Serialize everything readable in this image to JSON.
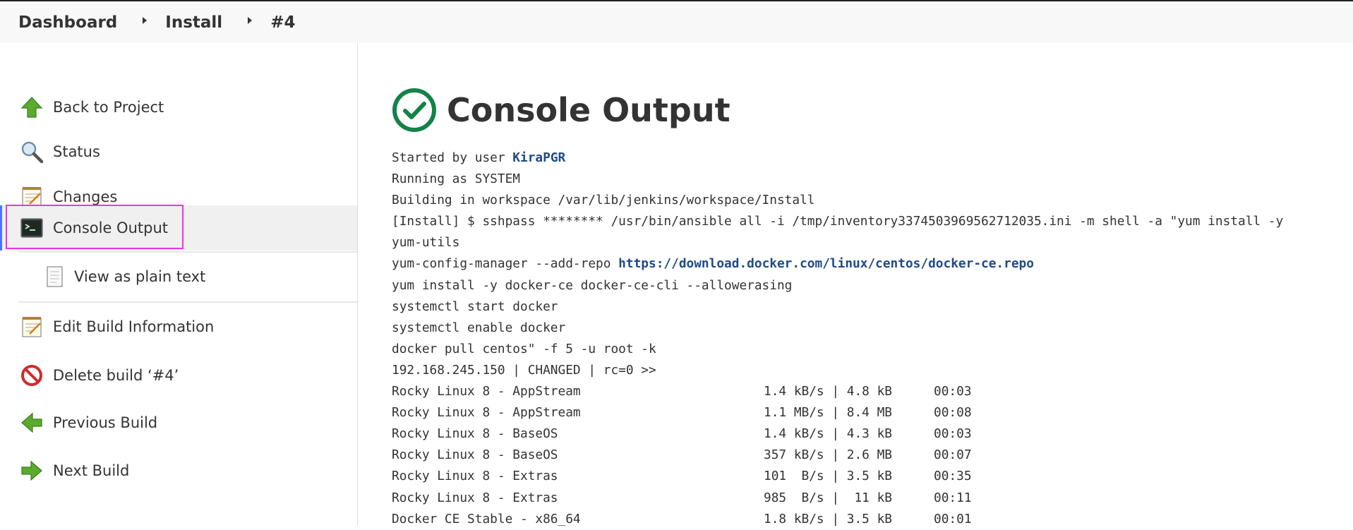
{
  "breadcrumb": {
    "items": [
      "Dashboard",
      "Install",
      "#4"
    ]
  },
  "sidebar": {
    "items": [
      {
        "label": "Back to Project",
        "icon": "up-arrow-icon"
      },
      {
        "label": "Status",
        "icon": "magnifier-icon"
      },
      {
        "label": "Changes",
        "icon": "notepad-icon"
      },
      {
        "label": "Console Output",
        "icon": "terminal-icon",
        "active": true
      },
      {
        "label": "View as plain text",
        "icon": "document-icon",
        "sub": true
      },
      {
        "label": "Edit Build Information",
        "icon": "notepad-icon"
      },
      {
        "label": "Delete build ‘#4’",
        "icon": "no-entry-icon"
      },
      {
        "label": "Previous Build",
        "icon": "left-arrow-icon"
      },
      {
        "label": "Next Build",
        "icon": "right-arrow-icon"
      }
    ]
  },
  "main": {
    "title": "Console Output",
    "status_color": "#138347",
    "console": {
      "started_prefix": "Started by user ",
      "user": "KiraPGR",
      "lines_a": [
        "Running as SYSTEM",
        "Building in workspace /var/lib/jenkins/workspace/Install",
        "[Install] $ sshpass ******** /usr/bin/ansible all -i /tmp/inventory3374503969562712035.ini -m shell -a \"yum install -y",
        "yum-utils"
      ],
      "repo_prefix": "yum-config-manager --add-repo ",
      "repo_url": "https://download.docker.com/linux/centos/docker-ce.repo",
      "lines_b": [
        "yum install -y docker-ce docker-ce-cli --allowerasing",
        "systemctl start docker",
        "systemctl enable docker",
        "docker pull centos\" -f 5 -u root -k",
        "192.168.245.150 | CHANGED | rc=0 >>"
      ],
      "downloads": [
        {
          "name": "Rocky Linux 8 - AppStream",
          "rate": "1.4 kB/s | 4.8 kB",
          "time": "00:03"
        },
        {
          "name": "Rocky Linux 8 - AppStream",
          "rate": "1.1 MB/s | 8.4 MB",
          "time": "00:08"
        },
        {
          "name": "Rocky Linux 8 - BaseOS",
          "rate": "1.4 kB/s | 4.3 kB",
          "time": "00:03"
        },
        {
          "name": "Rocky Linux 8 - BaseOS",
          "rate": "357 kB/s | 2.6 MB",
          "time": "00:07"
        },
        {
          "name": "Rocky Linux 8 - Extras",
          "rate": "101  B/s | 3.5 kB",
          "time": "00:35"
        },
        {
          "name": "Rocky Linux 8 - Extras",
          "rate": "985  B/s |  11 kB",
          "time": "00:11"
        },
        {
          "name": "Docker CE Stable - x86_64",
          "rate": "1.8 kB/s | 3.5 kB",
          "time": "00:01"
        }
      ]
    }
  }
}
